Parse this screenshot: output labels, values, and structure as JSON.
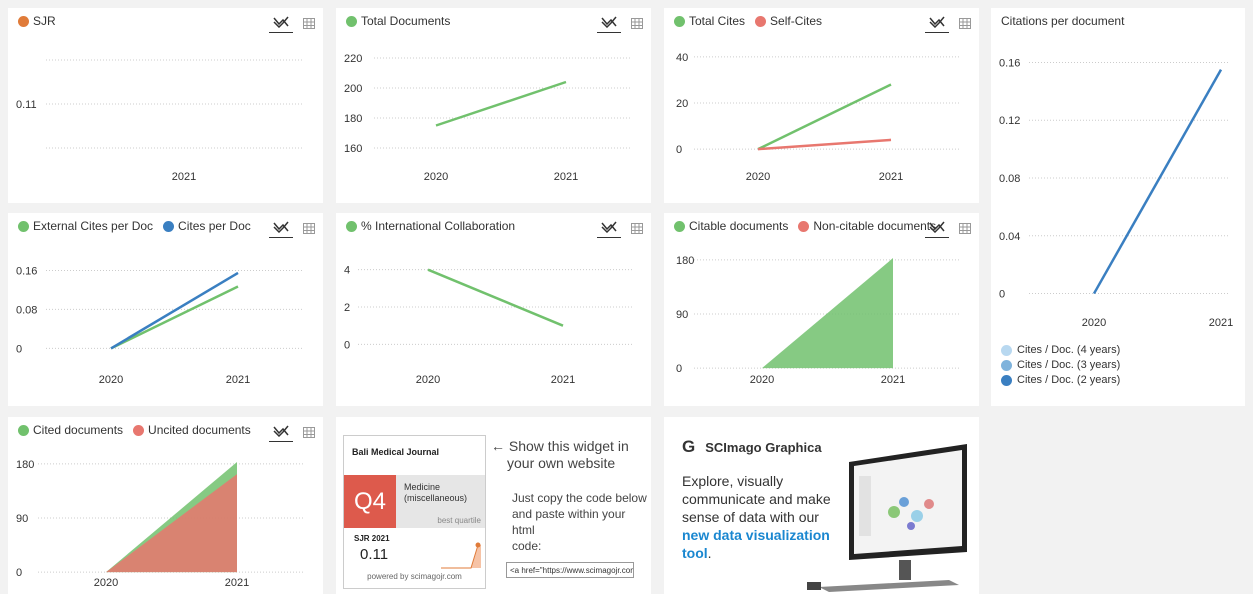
{
  "panels": {
    "sjr": {
      "legend": [
        {
          "label": "SJR",
          "color": "#e07b39"
        }
      ]
    },
    "docs": {
      "legend": [
        {
          "label": "Total Documents",
          "color": "#71c16d"
        }
      ]
    },
    "cites": {
      "legend": [
        {
          "label": "Total Cites",
          "color": "#71c16d"
        },
        {
          "label": "Self-Cites",
          "color": "#e8776f"
        }
      ]
    },
    "cpd": {
      "title": "Citations per document",
      "legend": [
        {
          "label": "Cites / Doc. (4 years)",
          "color": "#b8d8f0"
        },
        {
          "label": "Cites / Doc. (3 years)",
          "color": "#7fb3dc"
        },
        {
          "label": "Cites / Doc. (2 years)",
          "color": "#3a7fc1"
        }
      ]
    },
    "ext": {
      "legend": [
        {
          "label": "External Cites per Doc",
          "color": "#71c16d"
        },
        {
          "label": "Cites per Doc",
          "color": "#3a7fc1"
        }
      ]
    },
    "intl": {
      "legend": [
        {
          "label": "% International Collaboration",
          "color": "#71c16d"
        }
      ]
    },
    "citable": {
      "legend": [
        {
          "label": "Citable documents",
          "color": "#71c16d"
        },
        {
          "label": "Non-citable documents",
          "color": "#e8776f"
        }
      ]
    },
    "cited": {
      "legend": [
        {
          "label": "Cited documents",
          "color": "#71c16d"
        },
        {
          "label": "Uncited documents",
          "color": "#e8776f"
        }
      ]
    }
  },
  "chart_data": [
    {
      "id": "sjr",
      "type": "line",
      "x": [
        "2021"
      ],
      "series": [
        {
          "name": "SJR",
          "values": [
            0.11
          ]
        }
      ],
      "yticks": [
        "0.11"
      ]
    },
    {
      "id": "docs",
      "type": "line",
      "x": [
        "2020",
        "2021"
      ],
      "series": [
        {
          "name": "Total Documents",
          "values": [
            175,
            204
          ]
        }
      ],
      "ylim": [
        150,
        230
      ],
      "yticks": [
        160,
        180,
        200,
        220
      ]
    },
    {
      "id": "cites",
      "type": "line",
      "x": [
        "2020",
        "2021"
      ],
      "series": [
        {
          "name": "Total Cites",
          "values": [
            0,
            28
          ]
        },
        {
          "name": "Self-Cites",
          "values": [
            0,
            4
          ]
        }
      ],
      "ylim": [
        -6,
        46
      ],
      "yticks": [
        0,
        20,
        40
      ]
    },
    {
      "id": "cpd",
      "type": "line",
      "x": [
        "2020",
        "2021"
      ],
      "series": [
        {
          "name": "Cites / Doc. (2 years)",
          "values": [
            0,
            0.155
          ]
        }
      ],
      "ylim": [
        -0.01,
        0.17
      ],
      "yticks": [
        "0",
        "0.04",
        "0.08",
        "0.12",
        "0.16"
      ]
    },
    {
      "id": "ext",
      "type": "line",
      "x": [
        "2020",
        "2021"
      ],
      "series": [
        {
          "name": "External Cites per Doc",
          "values": [
            0,
            0.127
          ]
        },
        {
          "name": "Cites per Doc",
          "values": [
            0,
            0.155
          ]
        }
      ],
      "ylim": [
        -0.03,
        0.2
      ],
      "yticks": [
        "0",
        "0.08",
        "0.16"
      ]
    },
    {
      "id": "intl",
      "type": "line",
      "x": [
        "2020",
        "2021"
      ],
      "series": [
        {
          "name": "% International Collaboration",
          "values": [
            4,
            1
          ]
        }
      ],
      "ylim": [
        -1,
        5
      ],
      "yticks": [
        0,
        2,
        4
      ]
    },
    {
      "id": "citable",
      "type": "area",
      "x": [
        "2020",
        "2021"
      ],
      "series": [
        {
          "name": "Citable documents",
          "values": [
            0,
            183
          ]
        },
        {
          "name": "Non-citable documents",
          "values": [
            0,
            0
          ]
        }
      ],
      "ylim": [
        -8,
        208
      ],
      "yticks": [
        0,
        90,
        180
      ]
    },
    {
      "id": "cited",
      "type": "area",
      "x": [
        "2020",
        "2021"
      ],
      "series": [
        {
          "name": "Cited documents",
          "values": [
            0,
            183
          ]
        },
        {
          "name": "Uncited documents",
          "values": [
            0,
            163
          ]
        }
      ],
      "ylim": [
        -8,
        208
      ],
      "yticks": [
        0,
        90,
        180
      ]
    }
  ],
  "widget": {
    "journal": "Bali Medical Journal",
    "quartile": "Q4",
    "category_line1": "Medicine",
    "category_line2": "(miscellaneous)",
    "best_quartile": "best quartile",
    "sjr_label": "SJR 2021",
    "sjr_value": "0.11",
    "powered": "powered by scimagojr.com",
    "show_line1": "← Show this widget in",
    "show_line2": "your own website",
    "copy_line1": "Just copy the code below",
    "copy_line2": "and paste within your html",
    "copy_line3": "code:",
    "code": "<a href=\"https://www.scimagojr.com/journalsearch.php"
  },
  "graphica": {
    "title": "SCImago Graphica",
    "desc1": "Explore, visually communicate and make sense of data with our ",
    "link": "new data visualization tool",
    "desc2": "."
  },
  "icons": {
    "line": "line-chart-icon",
    "table": "table-icon"
  }
}
